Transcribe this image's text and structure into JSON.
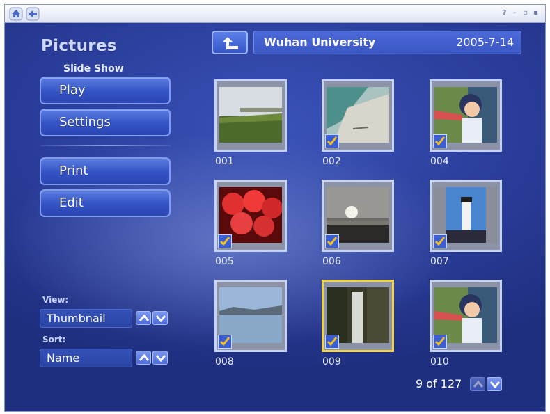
{
  "titlebar": {
    "home_icon": "home-icon",
    "back_icon": "back-arrow-icon",
    "controls": [
      {
        "name": "help-button",
        "glyph": "?"
      },
      {
        "name": "minimize-button",
        "glyph": "–"
      },
      {
        "name": "restore-button",
        "glyph": "▫"
      },
      {
        "name": "close-button",
        "glyph": "▪"
      }
    ]
  },
  "sidebar": {
    "title": "Pictures",
    "subtitle": "Slide Show",
    "buttons": {
      "play": "Play",
      "settings": "Settings",
      "print": "Print",
      "edit": "Edit"
    },
    "view": {
      "label": "View:",
      "value": "Thumbnail"
    },
    "sort": {
      "label": "Sort:",
      "value": "Name"
    }
  },
  "header": {
    "folder": "Wuhan University",
    "date": "2005-7-14"
  },
  "thumbnails": [
    {
      "label": "001",
      "checked": false,
      "selected": false,
      "scene": "field"
    },
    {
      "label": "002",
      "checked": true,
      "selected": false,
      "scene": "shore"
    },
    {
      "label": "004",
      "checked": true,
      "selected": false,
      "scene": "child"
    },
    {
      "label": "005",
      "checked": true,
      "selected": false,
      "scene": "flowers"
    },
    {
      "label": "006",
      "checked": true,
      "selected": false,
      "scene": "sunset"
    },
    {
      "label": "007",
      "checked": true,
      "selected": false,
      "scene": "lighthouse"
    },
    {
      "label": "008",
      "checked": true,
      "selected": false,
      "scene": "lake"
    },
    {
      "label": "009",
      "checked": true,
      "selected": true,
      "scene": "waterfall"
    },
    {
      "label": "010",
      "checked": true,
      "selected": false,
      "scene": "child"
    }
  ],
  "pager": {
    "text": "9 of 127"
  },
  "colors": {
    "background": "#2a3d9a",
    "button": "#3452c4",
    "selection": "#f0d248",
    "check": "#f0c020"
  }
}
